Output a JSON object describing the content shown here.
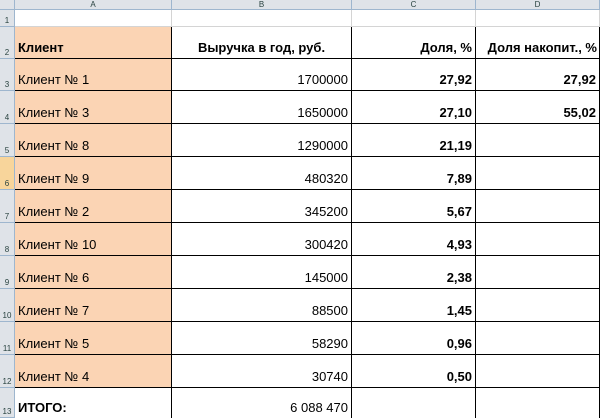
{
  "columns": [
    "A",
    "B",
    "C",
    "D"
  ],
  "rows": [
    "1",
    "2",
    "3",
    "4",
    "5",
    "6",
    "7",
    "8",
    "9",
    "10",
    "11",
    "12",
    "13"
  ],
  "header": {
    "client": "Клиент",
    "revenue": "Выручка в год, руб.",
    "share": "Доля, %",
    "cum_share": "Доля накопит., %"
  },
  "data": [
    {
      "client": "Клиент № 1",
      "revenue": "1700000",
      "share": "27,92",
      "cum": "27,92"
    },
    {
      "client": "Клиент № 3",
      "revenue": "1650000",
      "share": "27,10",
      "cum": "55,02"
    },
    {
      "client": "Клиент № 8",
      "revenue": "1290000",
      "share": "21,19",
      "cum": ""
    },
    {
      "client": "Клиент № 9",
      "revenue": "480320",
      "share": "7,89",
      "cum": ""
    },
    {
      "client": "Клиент № 2",
      "revenue": "345200",
      "share": "5,67",
      "cum": ""
    },
    {
      "client": "Клиент № 10",
      "revenue": "300420",
      "share": "4,93",
      "cum": ""
    },
    {
      "client": "Клиент № 6",
      "revenue": "145000",
      "share": "2,38",
      "cum": ""
    },
    {
      "client": "Клиент № 7",
      "revenue": "88500",
      "share": "1,45",
      "cum": ""
    },
    {
      "client": "Клиент № 5",
      "revenue": "58290",
      "share": "0,96",
      "cum": ""
    },
    {
      "client": "Клиент № 4",
      "revenue": "30740",
      "share": "0,50",
      "cum": ""
    }
  ],
  "total": {
    "label": "ИТОГО:",
    "value": "6 088 470"
  },
  "colors": {
    "client_fill": "#fbd4b4",
    "active_row_header": "#f8d59b",
    "header_bg": "#dfe3e8"
  }
}
